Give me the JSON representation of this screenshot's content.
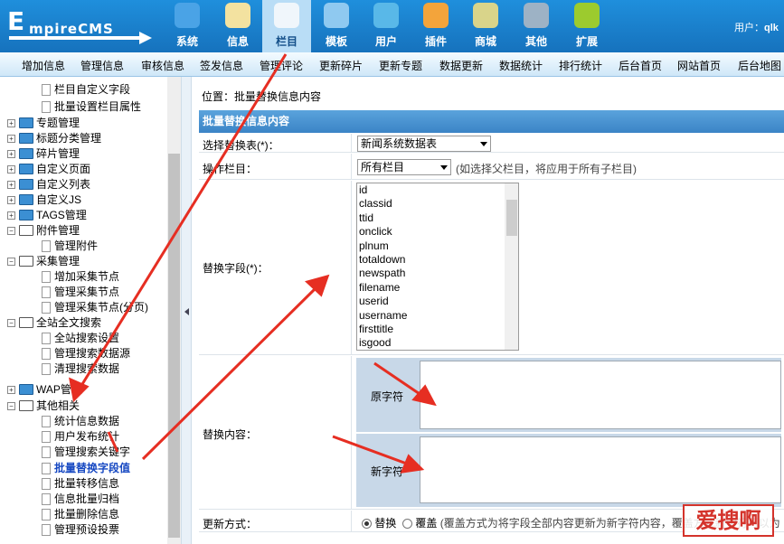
{
  "header": {
    "logo_text_1": "E",
    "logo_text_2": "mpireCMS",
    "user_label": "用户：",
    "user_name": "qlk"
  },
  "nav": [
    {
      "label": "系统",
      "icon": "globe-icon",
      "color": "#4aa3e6"
    },
    {
      "label": "信息",
      "icon": "notepad-icon",
      "color": "#f3e2a0"
    },
    {
      "label": "栏目",
      "icon": "folder-icon",
      "color": "#f0f6fb"
    },
    {
      "label": "模板",
      "icon": "window-icon",
      "color": "#8fc9f0"
    },
    {
      "label": "用户",
      "icon": "user-icon",
      "color": "#59b8e8"
    },
    {
      "label": "插件",
      "icon": "tools-icon",
      "color": "#f3a43b"
    },
    {
      "label": "商城",
      "icon": "card-icon",
      "color": "#d9d48a"
    },
    {
      "label": "其他",
      "icon": "gear-icon",
      "color": "#9db2c5"
    },
    {
      "label": "扩展",
      "icon": "plus-icon",
      "color": "#9ccb2e"
    }
  ],
  "menu": [
    "增加信息",
    "管理信息",
    "审核信息",
    "签发信息",
    "管理评论",
    "更新碎片",
    "更新专题",
    "数据更新",
    "数据统计",
    "排行统计",
    "后台首页",
    "网站首页",
    "后台地图"
  ],
  "tree": [
    {
      "t": "栏目自定义字段",
      "k": "doc"
    },
    {
      "t": "批量设置栏目属性",
      "k": "doc"
    },
    {
      "t": "专题管理",
      "k": "fold"
    },
    {
      "t": "标题分类管理",
      "k": "fold"
    },
    {
      "t": "碎片管理",
      "k": "fold"
    },
    {
      "t": "自定义页面",
      "k": "fold"
    },
    {
      "t": "自定义列表",
      "k": "fold"
    },
    {
      "t": "自定义JS",
      "k": "fold"
    },
    {
      "t": "TAGS管理",
      "k": "fold"
    },
    {
      "t": "附件管理",
      "k": "open"
    },
    {
      "t": "管理附件",
      "k": "doc"
    },
    {
      "t": "采集管理",
      "k": "open"
    },
    {
      "t": "增加采集节点",
      "k": "doc"
    },
    {
      "t": "管理采集节点",
      "k": "doc"
    },
    {
      "t": "管理采集节点(分页)",
      "k": "doc"
    },
    {
      "t": "全站全文搜索",
      "k": "open"
    },
    {
      "t": "全站搜索设置",
      "k": "doc"
    },
    {
      "t": "管理搜索数据源",
      "k": "doc"
    },
    {
      "t": "清理搜索数据",
      "k": "doc"
    },
    {
      "t": "WAP管理",
      "k": "fold"
    },
    {
      "t": "其他相关",
      "k": "open"
    },
    {
      "t": "统计信息数据",
      "k": "doc"
    },
    {
      "t": "用户发布统计",
      "k": "doc"
    },
    {
      "t": "管理搜索关键字",
      "k": "doc"
    },
    {
      "t": "批量替换字段值",
      "k": "doc",
      "sel": true
    },
    {
      "t": "批量转移信息",
      "k": "doc"
    },
    {
      "t": "信息批量归档",
      "k": "doc"
    },
    {
      "t": "批量删除信息",
      "k": "doc"
    },
    {
      "t": "管理预设投票",
      "k": "doc"
    }
  ],
  "main": {
    "location": "位置：批量替换信息内容",
    "form_title": "批量替换信息内容",
    "table_label": "选择替换表(*)：",
    "table_value": "新闻系统数据表",
    "column_label": "操作栏目：",
    "column_value": "所有栏目",
    "column_hint": "(如选择父栏目，将应用于所有子栏目)",
    "field_label": "替换字段(*)：",
    "fields": [
      "id",
      "classid",
      "ttid",
      "onclick",
      "plnum",
      "totaldown",
      "newspath",
      "filename",
      "userid",
      "username",
      "firsttitle",
      "isgood"
    ],
    "content_label": "替换内容：",
    "old_label": "原字符",
    "new_label": "新字符",
    "mode_label": "更新方式：",
    "mode_replace": "替换",
    "mode_cover": "覆盖",
    "mode_hint": "(覆盖方式为将字段全部内容更新为新字符内容，覆盖方式新字符可以为"
  },
  "watermark": "爱搜啊"
}
